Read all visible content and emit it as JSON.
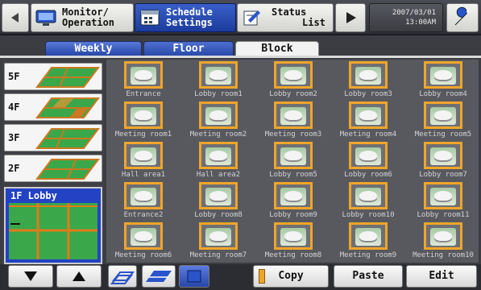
{
  "header": {
    "monitor_line1": "Monitor/",
    "monitor_line2": "Operation",
    "schedule_line1": "Schedule",
    "schedule_line2": "Settings",
    "status_line1": "Status",
    "status_line2": "List",
    "clock_date": "2007/03/01",
    "clock_time": "13:00AM"
  },
  "tabs": {
    "weekly": "Weekly",
    "floor": "Floor",
    "block": "Block"
  },
  "floors": [
    {
      "label": "5F"
    },
    {
      "label": "4F"
    },
    {
      "label": "3F"
    },
    {
      "label": "2F"
    }
  ],
  "selected_floor": {
    "label": "1F Lobby"
  },
  "groups": [
    "Entrance",
    "Lobby room1",
    "Lobby room2",
    "Lobby room3",
    "Lobby room4",
    "Meeting room1",
    "Meeting room2",
    "Meeting room3",
    "Meeting room4",
    "Meeting room5",
    "Hall area1",
    "Hall area2",
    "Lobby room5",
    "Lobby room6",
    "Lobby room7",
    "Entrance2",
    "Lobby room8",
    "Lobby room9",
    "Lobby room10",
    "Lobby room11",
    "Meeting room6",
    "Meeting room7",
    "Meeting room8",
    "Meeting room9",
    "Meeting room10"
  ],
  "bottom": {
    "copy": "Copy",
    "paste": "Paste",
    "edit": "Edit"
  },
  "colors": {
    "accent": "#2747a8",
    "highlight": "#f0a52a",
    "floor_map": "#3aa84a"
  },
  "icons": {
    "back": "back-icon",
    "monitor": "monitor-icon",
    "schedule": "schedule-icon",
    "status": "status-icon",
    "play": "play-icon",
    "tool": "wrench-icon"
  }
}
